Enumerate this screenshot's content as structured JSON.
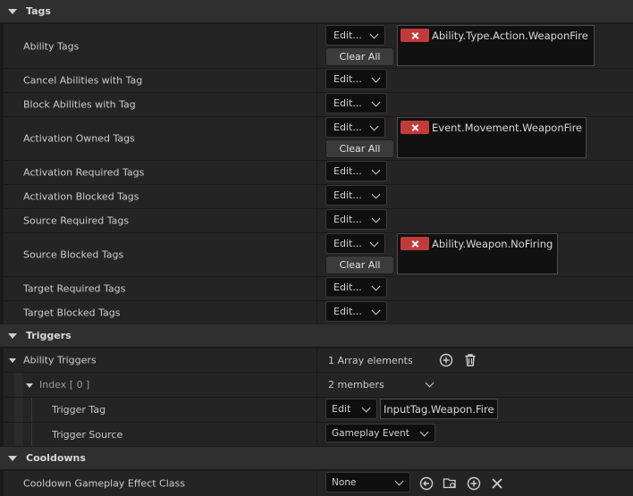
{
  "sections": {
    "tags": "Tags",
    "triggers": "Triggers",
    "cooldowns": "Cooldowns"
  },
  "tag_rows": [
    {
      "label": "Ability Tags",
      "tag": "Ability.Type.Action.WeaponFire"
    },
    {
      "label": "Cancel Abilities with Tag"
    },
    {
      "label": "Block Abilities with Tag"
    },
    {
      "label": "Activation Owned Tags",
      "tag": "Event.Movement.WeaponFire"
    },
    {
      "label": "Activation Required Tags"
    },
    {
      "label": "Activation Blocked Tags"
    },
    {
      "label": "Source Required Tags"
    },
    {
      "label": "Source Blocked Tags",
      "tag": "Ability.Weapon.NoFiring"
    },
    {
      "label": "Target Required Tags"
    },
    {
      "label": "Target Blocked Tags"
    }
  ],
  "common": {
    "edit_label": "Edit...",
    "clear_all": "Clear All"
  },
  "triggers": {
    "ability_triggers_label": "Ability Triggers",
    "array_count": "1 Array elements",
    "index_label": "Index [ 0 ]",
    "members": "2 members",
    "trigger_tag_label": "Trigger Tag",
    "trigger_tag_edit": "Edit",
    "trigger_tag_value": "InputTag.Weapon.Fire",
    "trigger_source_label": "Trigger Source",
    "trigger_source_value": "Gameplay Event"
  },
  "cooldowns": {
    "class_label": "Cooldown Gameplay Effect Class",
    "class_value": "None"
  }
}
